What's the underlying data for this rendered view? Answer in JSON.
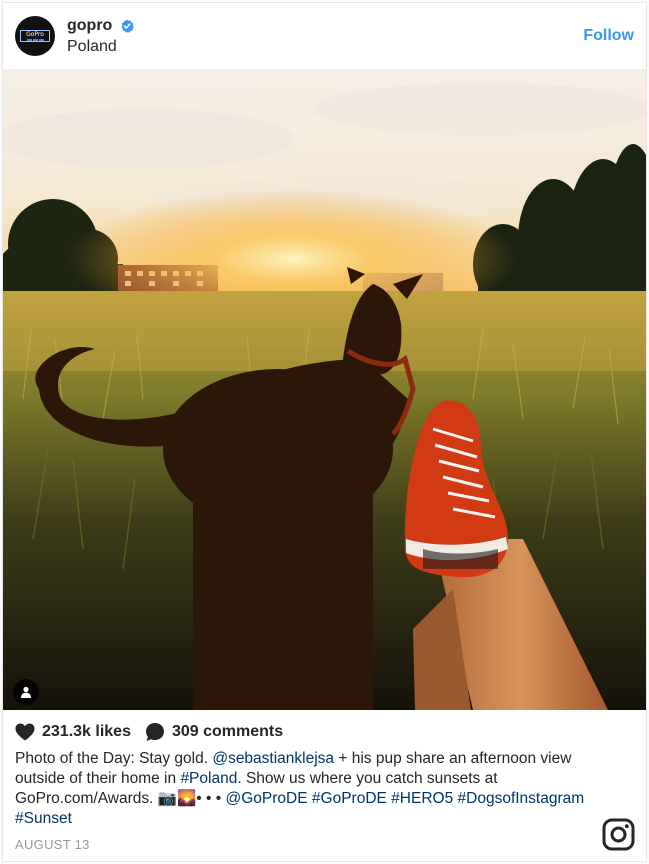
{
  "post": {
    "username": "gopro",
    "location": "Poland",
    "follow_label": "Follow",
    "avatar_text": "GoPro",
    "likes": "231.3k likes",
    "comments": "309 comments",
    "caption": {
      "text1": "Photo of the Day: Stay gold. ",
      "mention1": "@sebastianklejsa",
      "text2": " + his pup share an afternoon view outside of their home in ",
      "tag_poland": "#Poland",
      "text3": ". Show us where you catch sunsets at GoPro.com/Awards. 📷🌄• • • ",
      "mention2": "@GoProDE",
      "tag_gopro_de": "#GoProDE",
      "tag_hero5": "#HERO5",
      "tag_dogs": "#DogsofInstagram",
      "tag_sunset": "#Sunset"
    },
    "date": "AUGUST 13"
  },
  "colors": {
    "accent": "#3897f0",
    "link": "#003569",
    "text": "#262626",
    "muted": "#999999"
  },
  "icons": {
    "verified": "verified-badge-icon",
    "heart": "heart-icon",
    "comment": "comment-icon",
    "user_tag": "user-tag-icon",
    "instagram": "instagram-logo-icon"
  }
}
